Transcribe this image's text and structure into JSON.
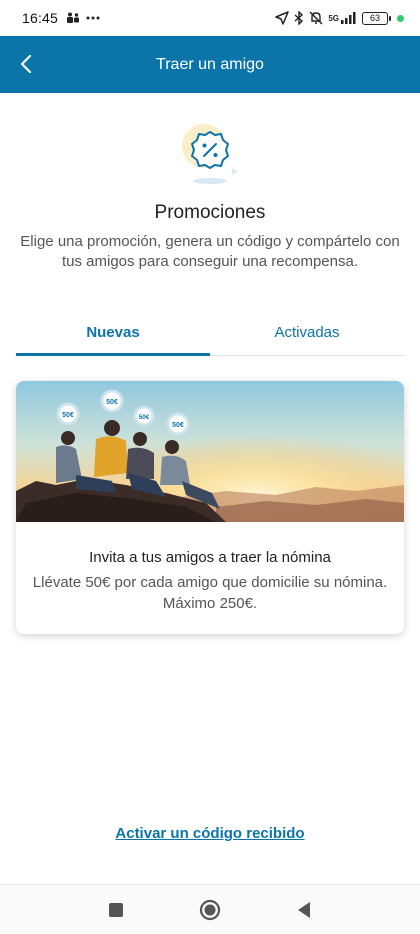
{
  "status_bar": {
    "time": "16:45",
    "battery": "63",
    "network": "5G",
    "icons": [
      "teams-icon",
      "more-dots-icon",
      "location-arrow-icon",
      "bluetooth-icon",
      "bell-muted-icon",
      "signal-icon",
      "battery-icon"
    ]
  },
  "header": {
    "title": "Traer un amigo",
    "background": "#0b74a8"
  },
  "hero": {
    "icon": "percent-badge-icon",
    "title": "Promociones",
    "description": "Elige una promoción, genera un código y compártelo con tus amigos para conseguir una recompensa."
  },
  "tabs": [
    {
      "label": "Nuevas",
      "active": true
    },
    {
      "label": "Activadas",
      "active": false
    }
  ],
  "card": {
    "badges": [
      "50€",
      "50€",
      "50€",
      "50€"
    ],
    "title": "Invita a tus amigos a traer la nómina",
    "text": "Llévate 50€ por cada amigo que domicilie su nómina. Máximo 250€."
  },
  "link": {
    "label": "Activar un código recibido"
  },
  "colors": {
    "accent": "#0b74a8",
    "text": "#222222",
    "muted": "#555555"
  }
}
